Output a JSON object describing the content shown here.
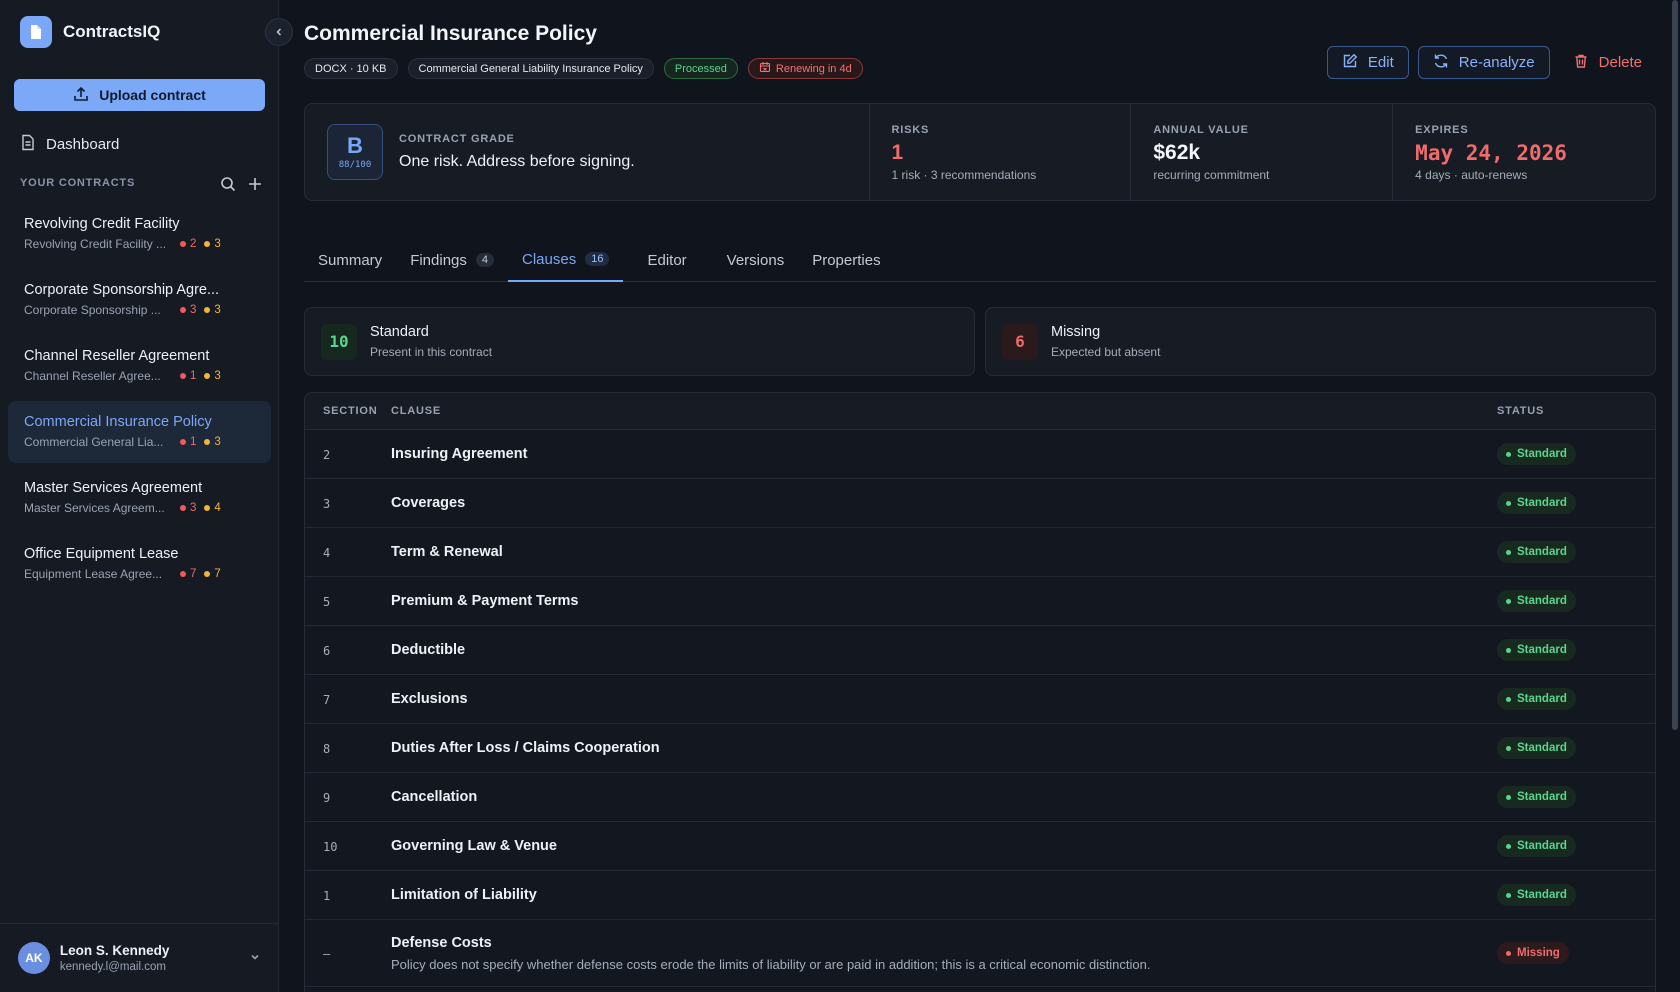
{
  "app": {
    "name": "ContractsIQ"
  },
  "sidebar": {
    "upload_label": "Upload contract",
    "dashboard_label": "Dashboard",
    "section_label": "YOUR CONTRACTS",
    "contracts": [
      {
        "title": "Revolving Credit Facility",
        "subtitle": "Revolving Credit Facility ...",
        "red": "2",
        "amber": "3",
        "active": false
      },
      {
        "title": "Corporate Sponsorship Agre...",
        "subtitle": "Corporate Sponsorship ...",
        "red": "3",
        "amber": "3",
        "active": false
      },
      {
        "title": "Channel Reseller Agreement",
        "subtitle": "Channel Reseller Agree...",
        "red": "1",
        "amber": "3",
        "active": false
      },
      {
        "title": "Commercial Insurance Policy",
        "subtitle": "Commercial General Lia...",
        "red": "1",
        "amber": "3",
        "active": true
      },
      {
        "title": "Master Services Agreement",
        "subtitle": "Master Services Agreem...",
        "red": "3",
        "amber": "4",
        "active": false
      },
      {
        "title": "Office Equipment Lease",
        "subtitle": "Equipment Lease Agree...",
        "red": "7",
        "amber": "7",
        "active": false
      }
    ],
    "user": {
      "initials": "AK",
      "name": "Leon S. Kennedy",
      "email": "kennedy.l@mail.com"
    }
  },
  "header": {
    "title": "Commercial Insurance Policy",
    "chips": {
      "file": "DOCX · 10 KB",
      "type": "Commercial General Liability Insurance Policy",
      "status": "Processed",
      "renewing": "Renewing in 4d"
    },
    "actions": {
      "edit": "Edit",
      "reanalyze": "Re-analyze",
      "delete": "Delete"
    }
  },
  "summary": {
    "grade": {
      "label": "CONTRACT GRADE",
      "letter": "B",
      "score": "88/100",
      "message": "One risk. Address before signing."
    },
    "risks": {
      "label": "RISKS",
      "value": "1",
      "sub": "1 risk · 3 recommendations"
    },
    "annual_value": {
      "label": "ANNUAL VALUE",
      "value": "$62k",
      "sub": "recurring commitment"
    },
    "expires": {
      "label": "EXPIRES",
      "value": "May 24, 2026",
      "sub": "4 days · auto-renews"
    }
  },
  "tabs": [
    {
      "label": "Summary",
      "count": ""
    },
    {
      "label": "Findings",
      "count": "4"
    },
    {
      "label": "Clauses",
      "count": "16",
      "active": true
    },
    {
      "label": "Editor",
      "count": ""
    },
    {
      "label": "Versions",
      "count": ""
    },
    {
      "label": "Properties",
      "count": ""
    }
  ],
  "clause_stats": {
    "standard": {
      "count": "10",
      "title": "Standard",
      "sub": "Present in this contract"
    },
    "missing": {
      "count": "6",
      "title": "Missing",
      "sub": "Expected but absent"
    }
  },
  "table": {
    "headers": {
      "section": "SECTION",
      "clause": "CLAUSE",
      "status": "STATUS"
    },
    "rows": [
      {
        "section": "2",
        "clause": "Insuring Agreement",
        "desc": "",
        "status": "Standard"
      },
      {
        "section": "3",
        "clause": "Coverages",
        "desc": "",
        "status": "Standard"
      },
      {
        "section": "4",
        "clause": "Term & Renewal",
        "desc": "",
        "status": "Standard"
      },
      {
        "section": "5",
        "clause": "Premium & Payment Terms",
        "desc": "",
        "status": "Standard"
      },
      {
        "section": "6",
        "clause": "Deductible",
        "desc": "",
        "status": "Standard"
      },
      {
        "section": "7",
        "clause": "Exclusions",
        "desc": "",
        "status": "Standard"
      },
      {
        "section": "8",
        "clause": "Duties After Loss / Claims Cooperation",
        "desc": "",
        "status": "Standard"
      },
      {
        "section": "9",
        "clause": "Cancellation",
        "desc": "",
        "status": "Standard"
      },
      {
        "section": "10",
        "clause": "Governing Law & Venue",
        "desc": "",
        "status": "Standard"
      },
      {
        "section": "1",
        "clause": "Limitation of Liability",
        "desc": "",
        "status": "Standard"
      },
      {
        "section": "—",
        "clause": "Defense Costs",
        "desc": "Policy does not specify whether defense costs erode the limits of liability or are paid in addition; this is a critical economic distinction.",
        "status": "Missing"
      }
    ]
  },
  "colors": {
    "accent": "#7aa7f7",
    "success": "#58d68d",
    "danger": "#f06b6b",
    "warning": "#f2b53c"
  }
}
